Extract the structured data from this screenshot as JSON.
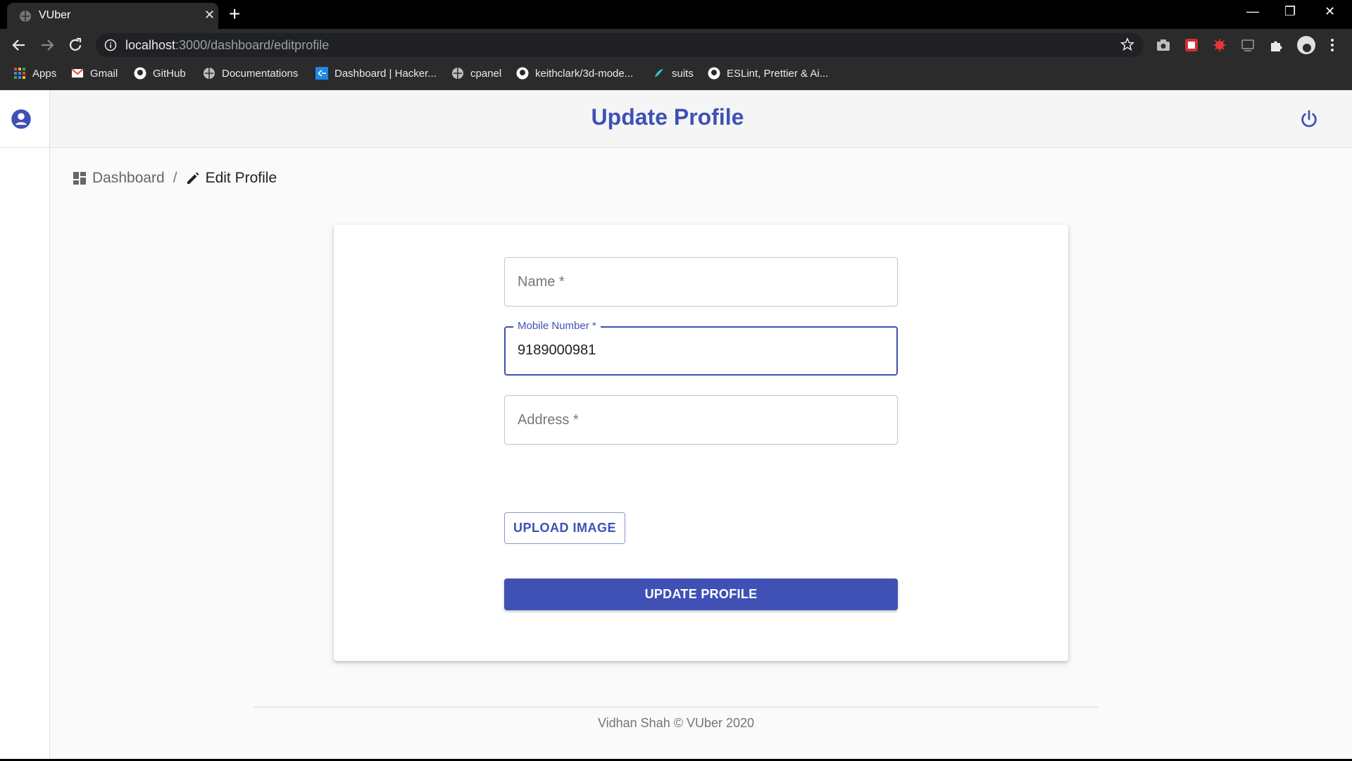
{
  "browser": {
    "tab_title": "VUber",
    "tab_close": "✕",
    "new_tab": "+",
    "url_host": "localhost",
    "url_rest": ":3000/dashboard/editprofile",
    "window_controls": [
      "—",
      "❐",
      "✕"
    ],
    "bookmarks": [
      {
        "label": "Apps",
        "icon": "apps-grid-icon"
      },
      {
        "label": "Gmail",
        "icon": "gmail-icon"
      },
      {
        "label": "GitHub",
        "icon": "github-icon"
      },
      {
        "label": "Documentations",
        "icon": "globe-icon"
      },
      {
        "label": "Dashboard | Hacker...",
        "icon": "hackerrank-icon"
      },
      {
        "label": "cpanel",
        "icon": "globe-icon"
      },
      {
        "label": "keithclark/3d-mode...",
        "icon": "github-icon"
      },
      {
        "label": "suits",
        "icon": "suits-icon"
      },
      {
        "label": "ESLint, Prettier & Ai...",
        "icon": "github-icon"
      }
    ]
  },
  "appbar": {
    "title": "Update Profile"
  },
  "breadcrumb": {
    "items": [
      "Dashboard",
      "Edit Profile"
    ],
    "separator": "/"
  },
  "form": {
    "name": {
      "label": "Name *",
      "value": ""
    },
    "mobile": {
      "label": "Mobile Number *",
      "value": "9189000981"
    },
    "address": {
      "label": "Address *",
      "value": ""
    },
    "upload_button": "UPLOAD IMAGE",
    "submit_button": "UPDATE PROFILE"
  },
  "footer": {
    "text": "Vidhan Shah © VUber 2020"
  },
  "colors": {
    "primary": "#3f51b5",
    "background": "#fafafa",
    "chrome": "#2b2b2c"
  }
}
